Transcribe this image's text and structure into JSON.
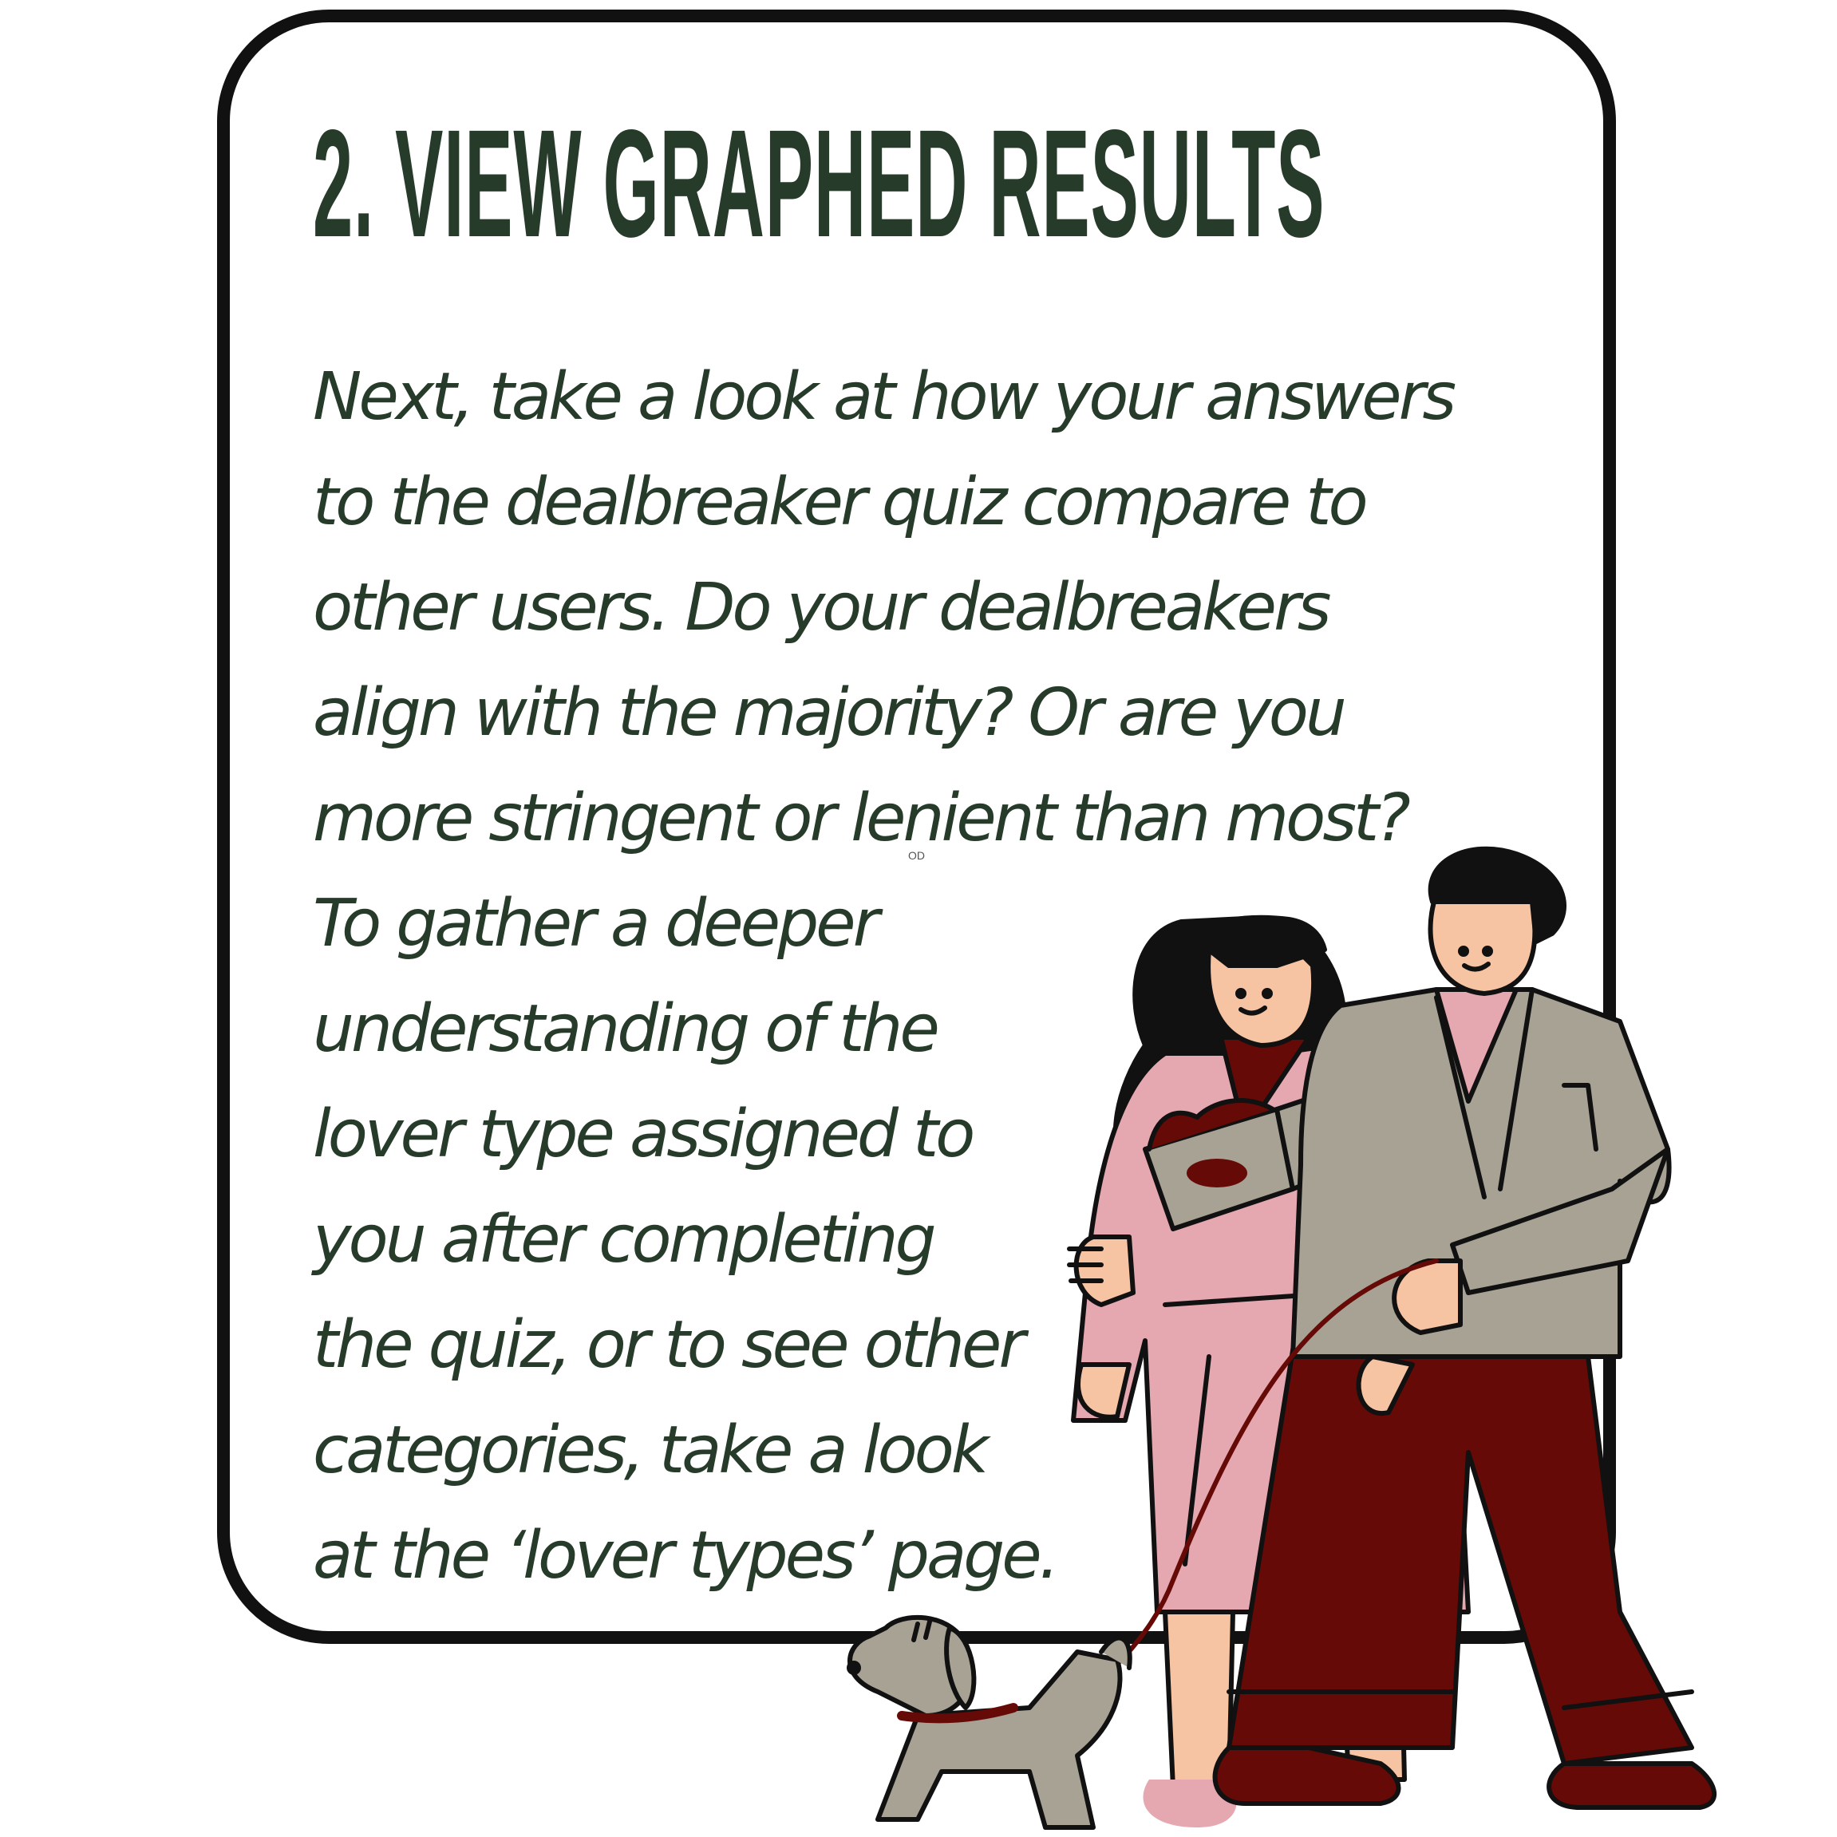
{
  "heading": "2. VIEW GRAPHED RESULTS",
  "body_lines": [
    "Next, take a look at how your answers",
    "to the dealbreaker quiz compare to",
    "other users. Do your dealbreakers",
    "align with the majority? Or are you",
    "more stringent or lenient than most?",
    "To gather a deeper",
    "understanding of the",
    "lover type assigned to",
    "you after completing",
    "the quiz, or to see other",
    "categories, take a look",
    "at the ‘lover types’ page."
  ],
  "watermark": "OD",
  "colors": {
    "text": "#263b29",
    "border": "#111111",
    "woman_coat": "#e5a8b0",
    "man_jacket": "#a8a295",
    "trousers": "#650a06",
    "skin": "#f6c3a3",
    "hair": "#111111",
    "dog": "#a8a295"
  }
}
